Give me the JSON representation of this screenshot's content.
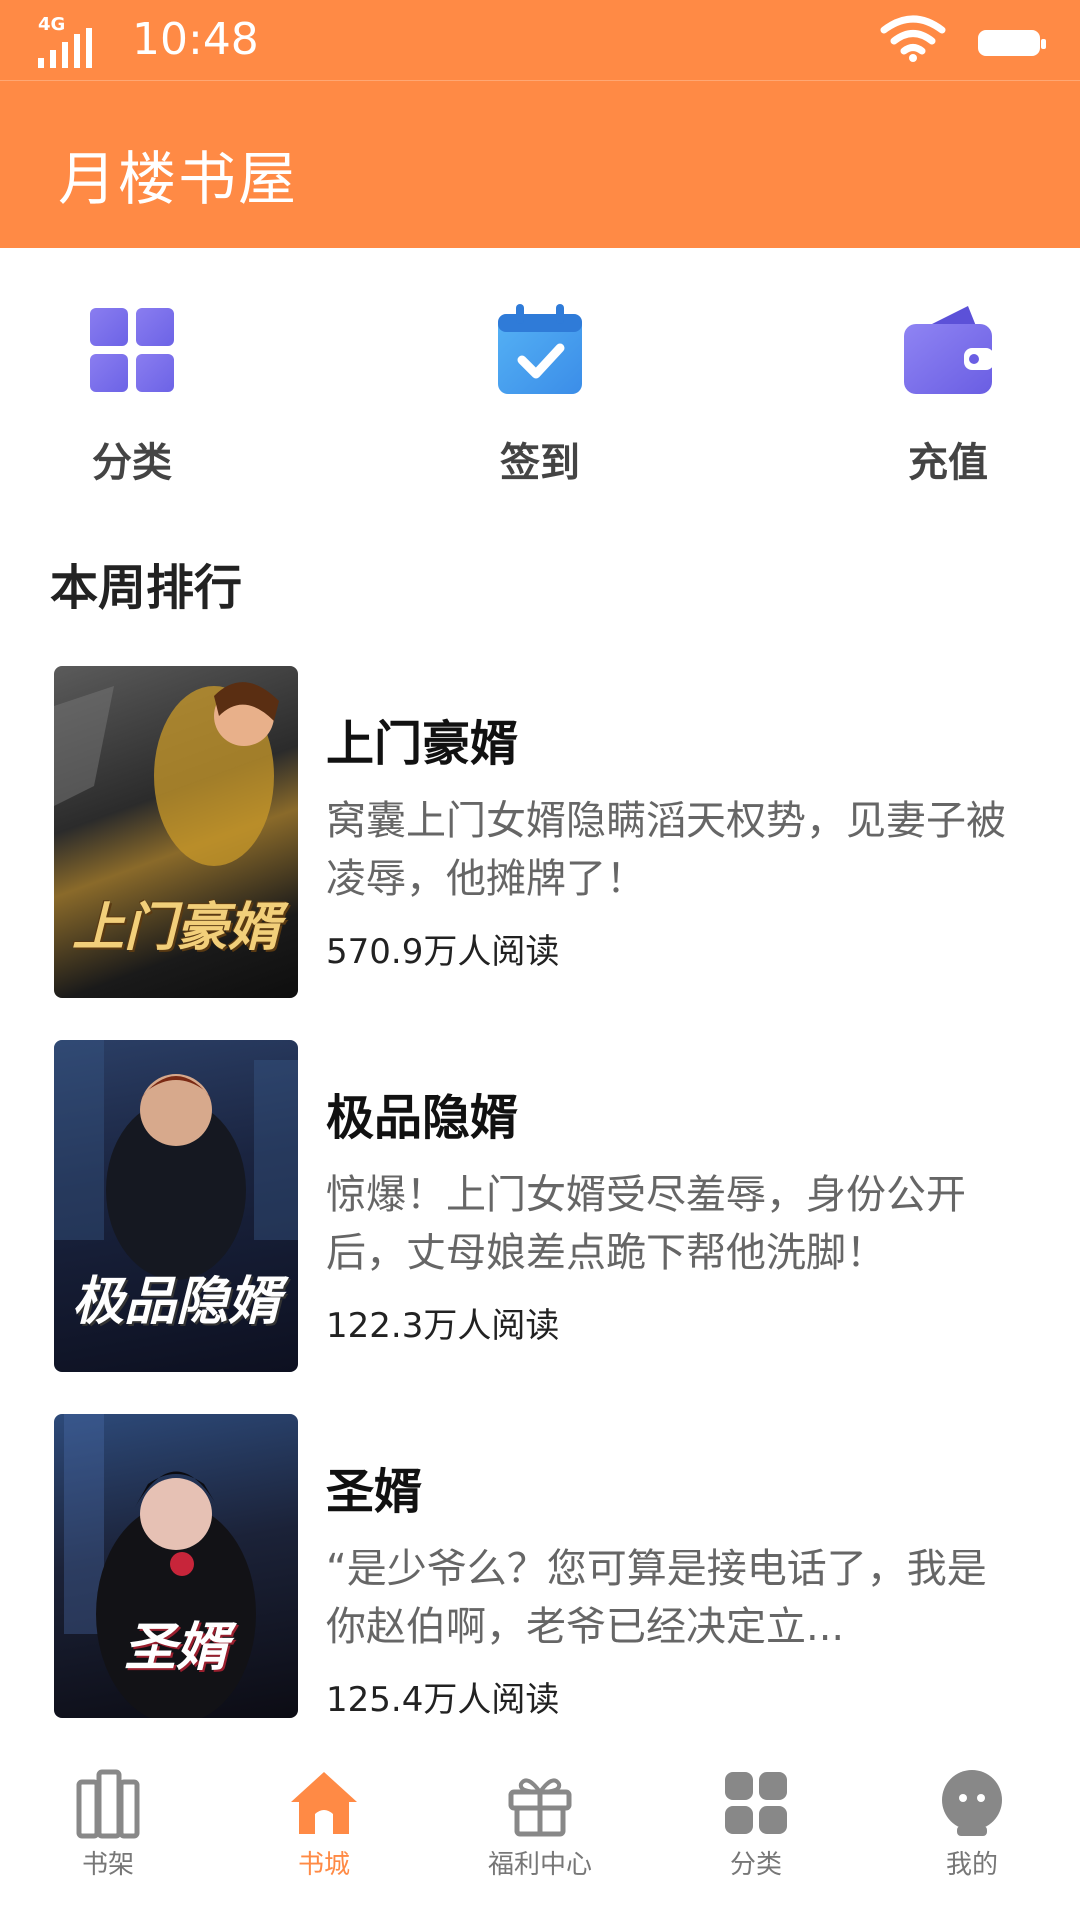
{
  "status": {
    "network": "4G",
    "time": "10:48"
  },
  "app": {
    "title": "月楼书屋",
    "accent": "#ff8a45"
  },
  "quick_actions": [
    {
      "label": "分类",
      "icon": "grid-icon"
    },
    {
      "label": "签到",
      "icon": "calendar-check-icon"
    },
    {
      "label": "充值",
      "icon": "wallet-icon"
    }
  ],
  "section": {
    "title": "本周排行"
  },
  "books": [
    {
      "title": "上门豪婿",
      "cover_text": "上门豪婿",
      "desc": "窝囊上门女婿隐瞒滔天权势，见妻子被凌辱，他摊牌了！",
      "reads": "570.9万人阅读"
    },
    {
      "title": "极品隐婿",
      "cover_text": "极品隐婿",
      "desc": "惊爆！上门女婿受尽羞辱，身份公开后，丈母娘差点跪下帮他洗脚！",
      "reads": "122.3万人阅读"
    },
    {
      "title": "圣婿",
      "cover_text": "圣婿",
      "desc": "“是少爷么？您可算是接电话了，我是你赵伯啊，老爷已经决定立...",
      "reads": "125.4万人阅读"
    }
  ],
  "nav": [
    {
      "label": "书架",
      "icon": "bookshelf-icon",
      "active": false
    },
    {
      "label": "书城",
      "icon": "home-icon",
      "active": true
    },
    {
      "label": "福利中心",
      "icon": "gift-icon",
      "active": false
    },
    {
      "label": "分类",
      "icon": "grid-icon",
      "active": false
    },
    {
      "label": "我的",
      "icon": "profile-icon",
      "active": false
    }
  ]
}
